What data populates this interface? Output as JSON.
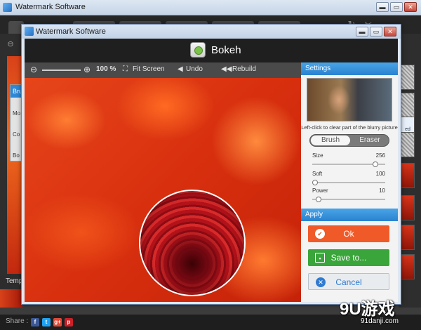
{
  "outer_window": {
    "title": "Watermark Software",
    "buttons": {
      "minimize": "▬",
      "maximize": "▭",
      "close": "✕"
    },
    "toolbar_icons": [
      "refresh-icon",
      "scissors-icon"
    ],
    "left_panel": {
      "header": "Brus",
      "options": [
        "Mo",
        "Co",
        "Bo"
      ]
    },
    "bottom_label": "Temp",
    "thumb_label": "ed",
    "share": {
      "label": "Share :",
      "networks": [
        "f",
        "t",
        "g+",
        "p"
      ]
    }
  },
  "dialog": {
    "title": "Watermark Software",
    "buttons": {
      "minimize": "▬",
      "maximize": "▭",
      "close": "✕"
    },
    "header_title": "Bokeh",
    "toolbar": {
      "zoom_percent": "100 %",
      "fit_screen": "Fit Screen",
      "undo": "Undo",
      "rebuild": "Rebuild"
    },
    "settings": {
      "header": "Settings",
      "hint": "Left-click to clear part of the blurry picture",
      "mode_brush": "Brush",
      "mode_eraser": "Eraser",
      "sliders": [
        {
          "label": "Size",
          "value": "256",
          "fraction": 0.9
        },
        {
          "label": "Soft",
          "value": "100",
          "fraction": 0.0
        },
        {
          "label": "Power",
          "value": "10",
          "fraction": 0.05
        }
      ]
    },
    "apply": {
      "header": "Apply",
      "ok": "Ok",
      "save": "Save to...",
      "cancel": "Cancel"
    }
  },
  "watermark": {
    "main": "9U游戏",
    "sub": "91danji.com"
  },
  "colors": {
    "accent_blue": "#2a82cf",
    "ok_orange": "#f05a28",
    "save_green": "#3aa53a",
    "cancel_blue": "#2f7bd0"
  }
}
